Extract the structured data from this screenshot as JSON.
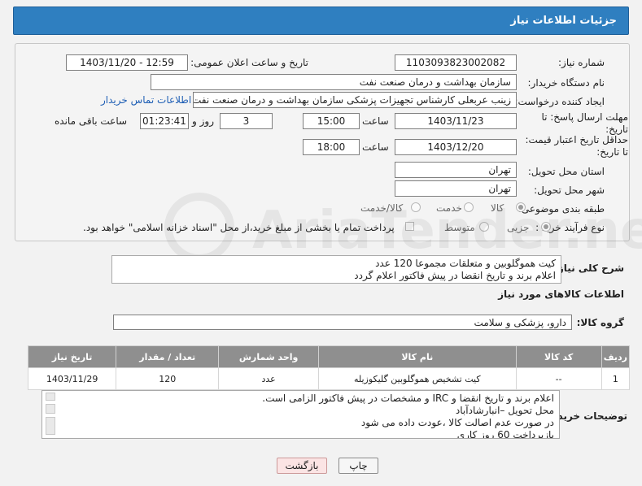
{
  "title": "جزئیات اطلاعات نیاز",
  "fields": {
    "need_number_label": "شماره نیاز:",
    "need_number": "1103093823002082",
    "announce_label": "تاریخ و ساعت اعلان عمومی:",
    "announce_value": "1403/11/20 - 12:59",
    "buyer_org_label": "نام دستگاه خریدار:",
    "buyer_org": "سازمان بهداشت و درمان صنعت نفت",
    "creator_label": "ایجاد کننده درخواست:",
    "creator": "زینب عربعلی کارشناس تجهیزات پزشکی سازمان بهداشت و درمان صنعت نفت",
    "buyer_contact_link": "اطلاعات تماس خریدار",
    "deadline_label": "مهلت ارسال پاسخ: تا تاریخ:",
    "deadline_date": "1403/11/23",
    "time_label": "ساعت",
    "deadline_time": "15:00",
    "days_value": "3",
    "days_label": "روز و",
    "remaining_time": "01:23:41",
    "remaining_label": "ساعت باقی مانده",
    "validity_label": "حداقل تاریخ اعتبار قیمت: تا تاریخ:",
    "validity_date": "1403/12/20",
    "validity_time": "18:00",
    "province_label": "استان محل تحویل:",
    "province": "تهران",
    "city_label": "شهر محل تحویل:",
    "city": "تهران",
    "category_label": "طبقه بندی موضوعی:",
    "category_options": [
      "کالا",
      "خدمت",
      "کالا/خدمت"
    ],
    "purchase_type_label": "نوع فرآیند خرید :",
    "purchase_options": [
      "جزیی",
      "متوسط"
    ],
    "payment_note": "پرداخت تمام یا بخشی از مبلغ خرید،از محل \"اسناد خزانه اسلامی\" خواهد بود."
  },
  "general_desc": {
    "label": "شرح کلی نیاز:",
    "lines": [
      "کیت هموگلوبین و متعلقات  مجموعا 120 عدد",
      "اعلام برند و تاریخ انقضا در پیش فاکتور اعلام گردد"
    ]
  },
  "goods_info_title": "اطلاعات کالاهای مورد نیاز",
  "goods_group": {
    "label": "گروه کالا:",
    "value": "دارو، پزشکی و سلامت"
  },
  "table": {
    "headers": [
      "ردیف",
      "کد کالا",
      "نام کالا",
      "واحد شمارش",
      "تعداد / مقدار",
      "تاریخ نیاز"
    ],
    "rows": [
      [
        "1",
        "--",
        "کیت تشخیص هموگلوبین گلیکوزیله",
        "عدد",
        "120",
        "1403/11/29"
      ]
    ]
  },
  "buyer_notes": {
    "label": "توضیحات خریدار:",
    "lines": [
      "اعلام برند و تاریخ انقضا  و IRC  و مشخصات  در پیش فاکتور الزامی است.",
      "محل تحویل –انبارشادآباد",
      "در صورت عدم اصالت کالا ،عودت داده می شود",
      "بازپرداخت 60 روز کاری"
    ]
  },
  "buttons": {
    "print": "چاپ",
    "back": "بازگشت"
  },
  "watermark": "AriaTender.neT"
}
